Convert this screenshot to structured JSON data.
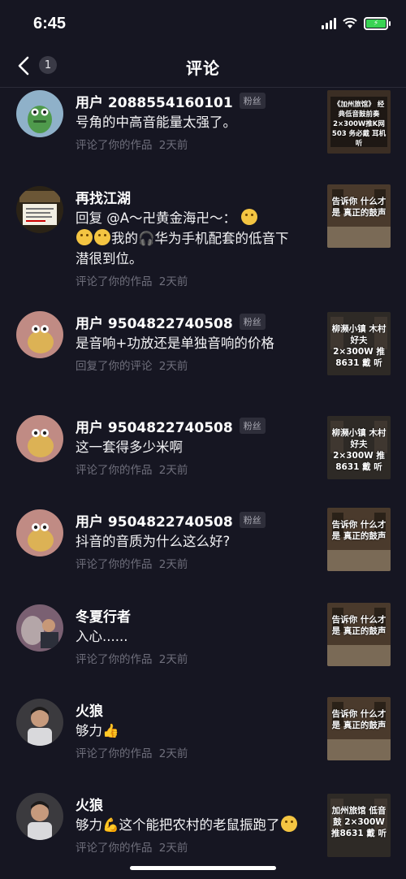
{
  "status": {
    "time": "6:45",
    "battery_color": "#39d353"
  },
  "nav": {
    "back_icon": "chevron-left-icon",
    "badge_count": "1",
    "title": "评论"
  },
  "comments": [
    {
      "username": "用户 2088554160101",
      "badge": "粉丝",
      "text": "号角的中高音能量太强了。",
      "meta": "评论了你的作品 2天前",
      "thumb_text": "《加州旅馆》 经典低音鼓前奏 2×300W推K网503 务必戴 耳机听"
    },
    {
      "username": "再找江湖",
      "badge": "",
      "text_part1": "回复 @A",
      "text_part2": "卍黄金海卍",
      "text_part3": "：",
      "text_part4": "我的",
      "text_part5": "华为手机配套的低音下潜很到位。",
      "meta": "评论了你的作品 2天前",
      "thumb_text": "告诉你 什么才是 真正的鼓声"
    },
    {
      "username": "用户 9504822740508",
      "badge": "粉丝",
      "text": "是音响+功放还是单独音响的价格",
      "meta": "回复了你的评论 2天前",
      "thumb_text": "柳濒小镇 木村好夫 2×300W 推8631 戴 听"
    },
    {
      "username": "用户 9504822740508",
      "badge": "粉丝",
      "text": "这一套得多少米啊",
      "meta": "评论了你的作品 2天前",
      "thumb_text": "柳濒小镇 木村好夫 2×300W 推8631 戴 听"
    },
    {
      "username": "用户 9504822740508",
      "badge": "粉丝",
      "text": "抖音的音质为什么这么好?",
      "meta": "评论了你的作品 2天前",
      "thumb_text": "告诉你 什么才是 真正的鼓声"
    },
    {
      "username": "冬夏行者",
      "badge": "",
      "text": "入心......",
      "meta": "评论了你的作品 2天前",
      "thumb_text": "告诉你 什么才是 真正的鼓声"
    },
    {
      "username": "火狼",
      "badge": "",
      "text": "够力",
      "meta": "评论了你的作品 2天前",
      "thumb_text": "告诉你 什么才是 真正的鼓声"
    },
    {
      "username": "火狼",
      "badge": "",
      "text_part1": "够力",
      "text_part2": "这个能把农村的老鼠振跑了",
      "meta": "评论了你的作品 2天前",
      "thumb_text": "加州旅馆 低音鼓 2×300W 推8631 戴 听"
    }
  ]
}
